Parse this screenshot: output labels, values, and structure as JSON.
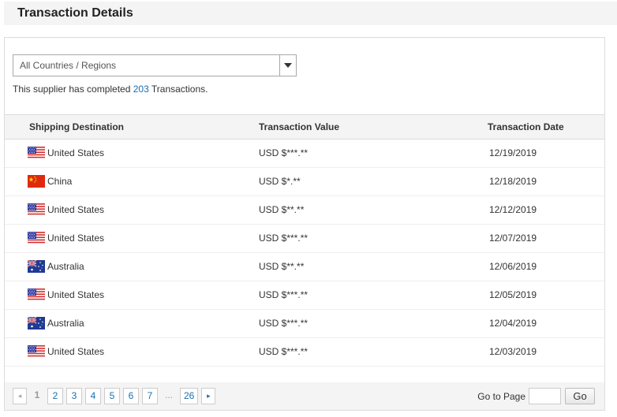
{
  "header": {
    "title": "Transaction Details"
  },
  "filter": {
    "selected": "All Countries / Regions"
  },
  "summary": {
    "prefix": "This supplier has completed ",
    "count": "203",
    "suffix": " Transactions."
  },
  "table": {
    "columns": [
      "Shipping Destination",
      "Transaction Value",
      "Transaction Date"
    ],
    "rows": [
      {
        "flag": "us-flag-icon",
        "country": "United States",
        "value": "USD $***.**",
        "date": "12/19/2019"
      },
      {
        "flag": "cn-flag-icon",
        "country": "China",
        "value": "USD $*.**",
        "date": "12/18/2019"
      },
      {
        "flag": "us-flag-icon",
        "country": "United States",
        "value": "USD $**.**",
        "date": "12/12/2019"
      },
      {
        "flag": "us-flag-icon",
        "country": "United States",
        "value": "USD $***.**",
        "date": "12/07/2019"
      },
      {
        "flag": "au-flag-icon",
        "country": "Australia",
        "value": "USD $**.**",
        "date": "12/06/2019"
      },
      {
        "flag": "us-flag-icon",
        "country": "United States",
        "value": "USD $***.**",
        "date": "12/05/2019"
      },
      {
        "flag": "au-flag-icon",
        "country": "Australia",
        "value": "USD $***.**",
        "date": "12/04/2019"
      },
      {
        "flag": "us-flag-icon",
        "country": "United States",
        "value": "USD $***.**",
        "date": "12/03/2019"
      }
    ]
  },
  "pagination": {
    "prev_icon": "◂",
    "next_icon": "▸",
    "current": "1",
    "pages": [
      "2",
      "3",
      "4",
      "5",
      "6",
      "7"
    ],
    "ellipsis": "...",
    "last": "26",
    "goto_label": "Go to Page",
    "goto_value": "",
    "go_button": "Go"
  },
  "colors": {
    "link": "#1a6fb0",
    "header_bg": "#f4f4f4",
    "border": "#dcdcdc"
  }
}
